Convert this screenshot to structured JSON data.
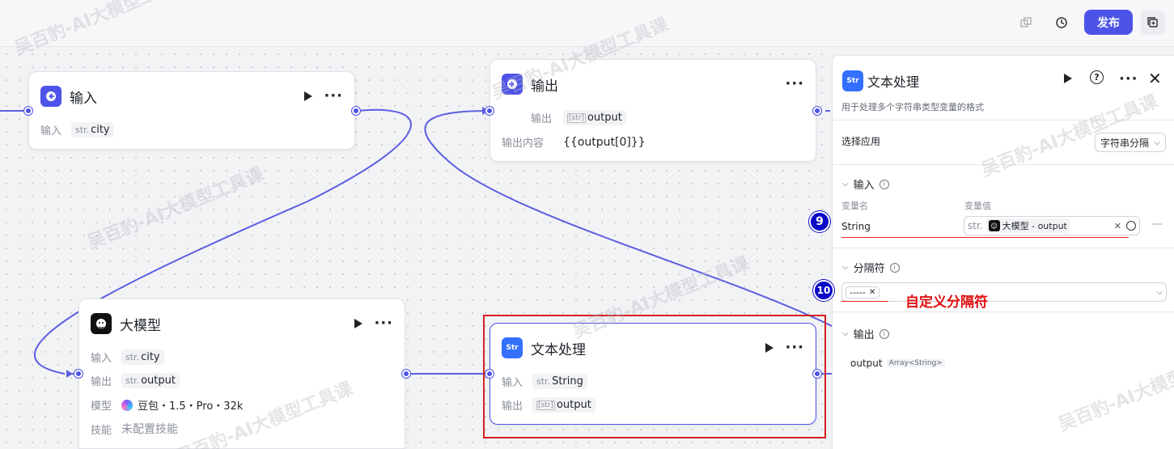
{
  "toolbar": {
    "publish_label": "发布",
    "icons": [
      "layers-icon",
      "history-icon",
      "copy-icon"
    ]
  },
  "nodes": {
    "input": {
      "title": "输入",
      "row_label": "输入",
      "var_prefix": "str.",
      "var_name": "city"
    },
    "output": {
      "title": "输出",
      "row1_label": "输出",
      "row1_prefix": "[str]",
      "row1_value": "output",
      "row2_label": "输出内容",
      "row2_value": "{{output[0]}}"
    },
    "llm": {
      "title": "大模型",
      "input_label": "输入",
      "input_prefix": "str.",
      "input_value": "city",
      "output_label": "输出",
      "output_prefix": "str.",
      "output_value": "output",
      "model_label": "模型",
      "model_value": "豆包・1.5・Pro・32k",
      "skill_label": "技能",
      "skill_value": "未配置技能"
    },
    "text": {
      "title": "文本处理",
      "input_label": "输入",
      "input_prefix": "str.",
      "input_value": "String",
      "output_label": "输出",
      "output_prefix": "[str]",
      "output_value": "output"
    }
  },
  "panel": {
    "title": "文本处理",
    "description": "用于处理多个字符串类型变量的格式",
    "select_app_label": "选择应用",
    "select_app_value": "字符串分隔",
    "input_section": "输入",
    "col_var_name": "变量名",
    "col_var_value": "变量值",
    "var_name": "String",
    "var_prefix": "str.",
    "var_source": "大模型 - output",
    "separator_section": "分隔符",
    "separator_value": "-----",
    "output_section": "输出",
    "output_name": "output",
    "output_type": "Array<String>"
  },
  "annotations": {
    "badge9": "9",
    "badge10": "10",
    "custom_separator_note": "自定义分隔符"
  },
  "watermark": "吴百豹-AI大模型工具课",
  "colors": {
    "accent": "#4d53e8",
    "highlight_red": "#d71f1f",
    "badge_blue": "#0a0ac8"
  }
}
